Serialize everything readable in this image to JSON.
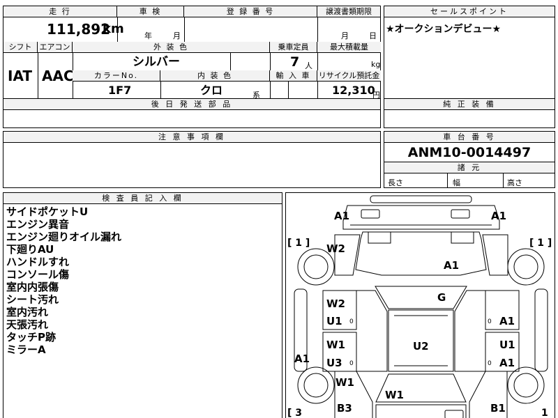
{
  "sheet": {
    "mileage": {
      "header": "走 行",
      "value": "111,892",
      "unit": "km"
    },
    "inspection": {
      "header": "車 検",
      "year_unit": "年",
      "month_unit": "月"
    },
    "registration": {
      "header": "登 録 番 号"
    },
    "transfer": {
      "header": "譲渡書類期限",
      "month_unit": "月",
      "day_unit": "日"
    },
    "sales_point": {
      "header": "セールスポイント",
      "text": "★オークションデビュー★"
    },
    "shift": {
      "header": "シフト",
      "value": "IAT"
    },
    "aircon": {
      "header": "エアコン",
      "value": "AAC"
    },
    "exterior_color": {
      "header": "外 装 色",
      "value": "シルバー"
    },
    "capacity": {
      "header": "乗車定員",
      "value": "7",
      "unit": "人"
    },
    "max_load": {
      "header": "最大積載量",
      "unit": "kg"
    },
    "color_no": {
      "header": "カラーNo.",
      "value": "1F7"
    },
    "interior_color": {
      "header": "内 装 色",
      "value": "クロ",
      "suffix": "系"
    },
    "import": {
      "header": "輸 入 車"
    },
    "recycle": {
      "header": "リサイクル預託金",
      "value": "12,310",
      "unit": "円"
    },
    "parts": {
      "header": "後 日 発 送 部 品"
    },
    "genuine": {
      "header": "純 正 装 備"
    },
    "notes": {
      "header": "注 意 事 項 欄"
    },
    "chassis": {
      "header": "車 台 番 号",
      "value": "ANM10-0014497"
    },
    "specs": {
      "header": "諸 元",
      "length": "長さ",
      "width": "幅",
      "height": "高さ"
    },
    "inspector": {
      "header": "検 査 員 記 入 欄",
      "remarks": [
        "サイドポケットU",
        "エンジン異音",
        "エンジン廻りオイル漏れ",
        "下廻りAU",
        "ハンドルすれ",
        "コンソール傷",
        "室内内張傷",
        "シート汚れ",
        "室内汚れ",
        "天張汚れ",
        "タッチP跡",
        "ミラーA"
      ]
    },
    "diagram": {
      "markers": {
        "front_left_top": "A1",
        "front_right_top": "A1",
        "bracket_left_top": "[ 1 ]",
        "bracket_right_top": "[ 1 ]",
        "bracket_left_bottom": "[ 3",
        "bracket_right_bottom": "1",
        "left_fender": "W2",
        "hood": "A1",
        "windshield": "G",
        "left_front_door_1": "W2",
        "left_front_door_2": "U1",
        "left_rear_door_1": "W1",
        "left_rear_door_2": "U3",
        "left_sill": "A1",
        "left_quarter": "W1",
        "left_rear": "B3",
        "right_front_door": "A1",
        "right_rear_door_1": "U1",
        "right_rear_door_2": "A1",
        "roof": "U2",
        "rear_glass": "W1",
        "right_rear": "B1",
        "zero": "0"
      }
    }
  }
}
